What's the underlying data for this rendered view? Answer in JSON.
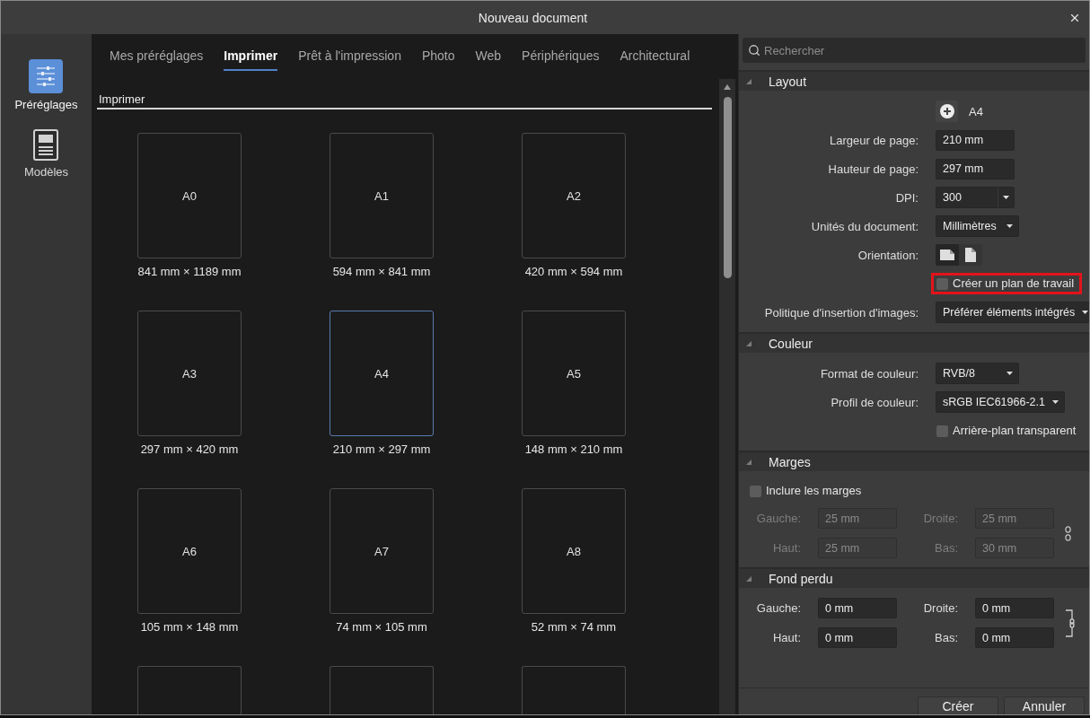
{
  "window": {
    "title": "Nouveau document"
  },
  "sidebar": {
    "items": [
      {
        "label": "Préréglages",
        "kind": "presets",
        "selected": true
      },
      {
        "label": "Modèles",
        "kind": "templates",
        "selected": false
      }
    ]
  },
  "tabs": [
    {
      "label": "Mes préréglages",
      "selected": false
    },
    {
      "label": "Imprimer",
      "selected": true
    },
    {
      "label": "Prêt à l'impression",
      "selected": false
    },
    {
      "label": "Photo",
      "selected": false
    },
    {
      "label": "Web",
      "selected": false
    },
    {
      "label": "Périphériques",
      "selected": false
    },
    {
      "label": "Architectural",
      "selected": false
    }
  ],
  "preset_group": {
    "title": "Imprimer",
    "presets": [
      {
        "name": "A0",
        "size": "841 mm × 1189 mm",
        "selected": false
      },
      {
        "name": "A1",
        "size": "594 mm × 841 mm",
        "selected": false
      },
      {
        "name": "A2",
        "size": "420 mm × 594 mm",
        "selected": false
      },
      {
        "name": "A3",
        "size": "297 mm × 420 mm",
        "selected": false
      },
      {
        "name": "A4",
        "size": "210 mm × 297 mm",
        "selected": true
      },
      {
        "name": "A5",
        "size": "148 mm × 210 mm",
        "selected": false
      },
      {
        "name": "A6",
        "size": "105 mm × 148 mm",
        "selected": false
      },
      {
        "name": "A7",
        "size": "74 mm × 105 mm",
        "selected": false
      },
      {
        "name": "A8",
        "size": "52 mm × 74 mm",
        "selected": false
      },
      {
        "selected": false
      },
      {
        "selected": false
      },
      {
        "selected": false
      }
    ]
  },
  "search": {
    "placeholder": "Rechercher"
  },
  "sections": [
    {
      "title": "Layout",
      "expanded": true,
      "rows": [
        {
          "kind": "preset",
          "value": "A4"
        },
        {
          "kind": "field",
          "label": "Largeur de page:",
          "value": "210 mm"
        },
        {
          "kind": "field",
          "label": "Hauteur de page:",
          "value": "297 mm"
        },
        {
          "kind": "combo",
          "label": "DPI:",
          "value": "300"
        },
        {
          "kind": "dropdown",
          "label": "Unités du document:",
          "value": "Millimètres"
        },
        {
          "kind": "orientation",
          "label": "Orientation:",
          "options": [
            {
              "kind": "landscape",
              "selected": false
            },
            {
              "kind": "portrait",
              "selected": true
            }
          ]
        },
        {
          "kind": "checkbox",
          "label": "Créer un plan de travail",
          "checked": false,
          "highlighted": true
        },
        {
          "kind": "dropdown",
          "label": "Politique d'insertion d'images:",
          "value": "Préférer éléments intégrés"
        }
      ]
    },
    {
      "title": "Couleur",
      "expanded": true,
      "rows": [
        {
          "kind": "dropdown",
          "label": "Format de couleur:",
          "value": "RVB/8"
        },
        {
          "kind": "dropdown",
          "label": "Profil de couleur:",
          "value": "sRGB IEC61966-2.1"
        },
        {
          "kind": "checkbox",
          "label": "Arrière-plan transparent",
          "checked": false,
          "highlighted": false
        }
      ]
    },
    {
      "title": "Marges",
      "expanded": true,
      "rows": [
        {
          "kind": "lead_checkbox",
          "label": "Inclure les marges",
          "checked": false
        },
        {
          "kind": "sides",
          "disabled": true,
          "linked": false,
          "fields": [
            {
              "label": "Gauche:",
              "value": "25 mm"
            },
            {
              "label": "Droite:",
              "value": "25 mm"
            },
            {
              "label": "Haut:",
              "value": "25 mm"
            },
            {
              "label": "Bas:",
              "value": "30 mm"
            }
          ]
        }
      ]
    },
    {
      "title": "Fond perdu",
      "expanded": true,
      "rows": [
        {
          "kind": "sides",
          "disabled": false,
          "linked": true,
          "fields": [
            {
              "label": "Gauche:",
              "value": "0 mm"
            },
            {
              "label": "Droite:",
              "value": "0 mm"
            },
            {
              "label": "Haut:",
              "value": "0 mm"
            },
            {
              "label": "Bas:",
              "value": "0 mm"
            }
          ]
        }
      ]
    }
  ],
  "buttons": [
    {
      "label": "Créer"
    },
    {
      "label": "Annuler"
    }
  ]
}
